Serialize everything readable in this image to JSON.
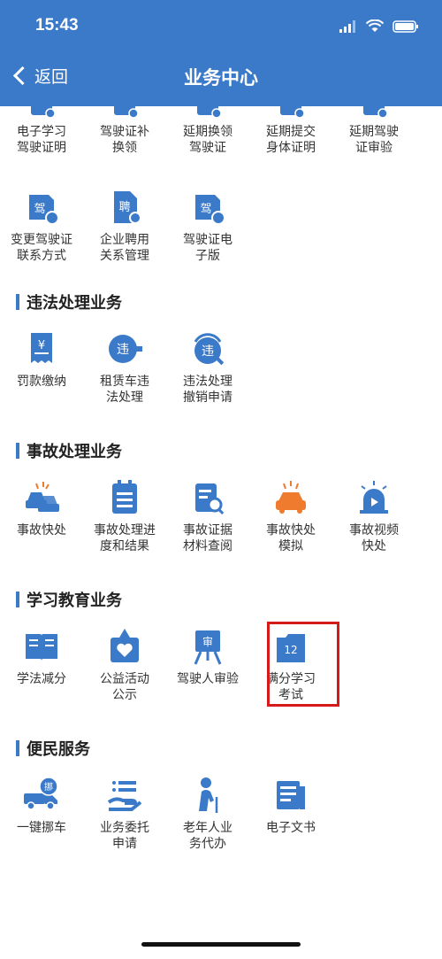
{
  "status": {
    "time": "15:43"
  },
  "nav": {
    "back_label": "返回",
    "title": "业务中心"
  },
  "top_row": [
    {
      "label": "电子学习\n驾驶证明",
      "icon": "license-icon"
    },
    {
      "label": "驾驶证补\n换领",
      "icon": "license-icon"
    },
    {
      "label": "延期换领\n驾驶证",
      "icon": "license-icon"
    },
    {
      "label": "延期提交\n身体证明",
      "icon": "license-icon"
    },
    {
      "label": "延期驾驶\n证审验",
      "icon": "license-icon"
    }
  ],
  "second_row": [
    {
      "label": "变更驾驶证\n联系方式",
      "glyph": "驾"
    },
    {
      "label": "企业聘用\n关系管理",
      "glyph": "聘"
    },
    {
      "label": "驾驶证电\n子版",
      "glyph": "驾"
    }
  ],
  "sections": [
    {
      "title": "违法处理业务",
      "items": [
        {
          "label": "罚款缴纳",
          "glyph": "¥"
        },
        {
          "label": "租赁车违\n法处理",
          "glyph": "违"
        },
        {
          "label": "违法处理\n撤销申请",
          "glyph": "违"
        }
      ]
    },
    {
      "title": "事故处理业务",
      "items": [
        {
          "label": "事故快处",
          "glyph": ""
        },
        {
          "label": "事故处理进\n度和结果",
          "glyph": ""
        },
        {
          "label": "事故证据\n材料查阅",
          "glyph": ""
        },
        {
          "label": "事故快处\n模拟",
          "glyph": ""
        },
        {
          "label": "事故视频\n快处",
          "glyph": ""
        }
      ]
    },
    {
      "title": "学习教育业务",
      "items": [
        {
          "label": "学法减分",
          "glyph": ""
        },
        {
          "label": "公益活动\n公示",
          "glyph": ""
        },
        {
          "label": "驾驶人审验",
          "glyph": "审"
        },
        {
          "label": "满分学习\n考试",
          "glyph": "12"
        }
      ]
    },
    {
      "title": "便民服务",
      "items": [
        {
          "label": "一键挪车",
          "glyph": "挪"
        },
        {
          "label": "业务委托\n申请",
          "glyph": ""
        },
        {
          "label": "老年人业\n务代办",
          "glyph": ""
        },
        {
          "label": "电子文书",
          "glyph": ""
        }
      ]
    }
  ],
  "colors": {
    "brand": "#3b79c9",
    "accent_orange": "#ee7b2e",
    "highlight": "#d61a1a"
  }
}
